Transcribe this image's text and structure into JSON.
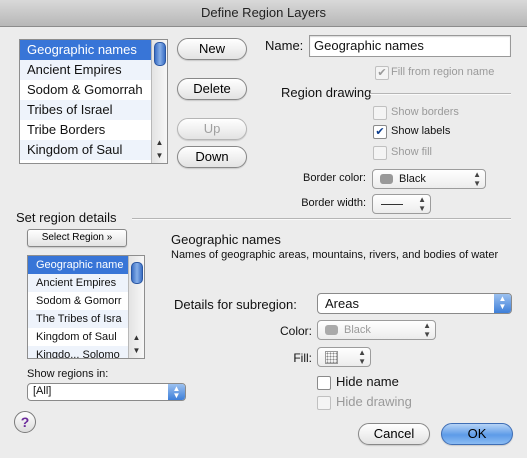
{
  "window": {
    "title": "Define Region Layers"
  },
  "layers_list": {
    "items": [
      {
        "label": "Geographic names",
        "selected": true
      },
      {
        "label": "Ancient Empires",
        "selected": false
      },
      {
        "label": "Sodom & Gomorrah",
        "selected": false
      },
      {
        "label": "Tribes of Israel",
        "selected": false
      },
      {
        "label": "Tribe Borders",
        "selected": false
      },
      {
        "label": "Kingdom of Saul",
        "selected": false
      }
    ]
  },
  "buttons": {
    "new": "New",
    "delete": "Delete",
    "up": "Up",
    "down": "Down",
    "select_region": "Select Region »",
    "cancel": "Cancel",
    "ok": "OK",
    "help": "?"
  },
  "name": {
    "label": "Name:",
    "value": "Geographic names",
    "fill_from_region": "Fill from region name"
  },
  "region_drawing": {
    "heading": "Region drawing",
    "show_borders": "Show borders",
    "show_labels": "Show labels",
    "show_fill": "Show fill",
    "border_color_label": "Border color:",
    "border_color_value": "Black",
    "border_width_label": "Border width:"
  },
  "region_details": {
    "heading": "Set region details",
    "regions": [
      {
        "label": "Geographic name",
        "selected": true
      },
      {
        "label": "Ancient Empires",
        "selected": false
      },
      {
        "label": "Sodom & Gomorr",
        "selected": false
      },
      {
        "label": "The Tribes of Isra",
        "selected": false
      },
      {
        "label": "Kingdom of Saul",
        "selected": false
      },
      {
        "label": "Kingdo... Solomo",
        "selected": false
      }
    ],
    "show_regions_in_label": "Show regions in:",
    "show_regions_in_value": "[All]",
    "info_title": "Geographic names",
    "info_desc": "Names of geographic areas, mountains, rivers, and bodies of water",
    "subregion_label": "Details for subregion:",
    "subregion_value": "Areas",
    "color_label": "Color:",
    "color_value": "Black",
    "fill_label": "Fill:",
    "hide_name": "Hide name",
    "hide_drawing": "Hide drawing"
  }
}
